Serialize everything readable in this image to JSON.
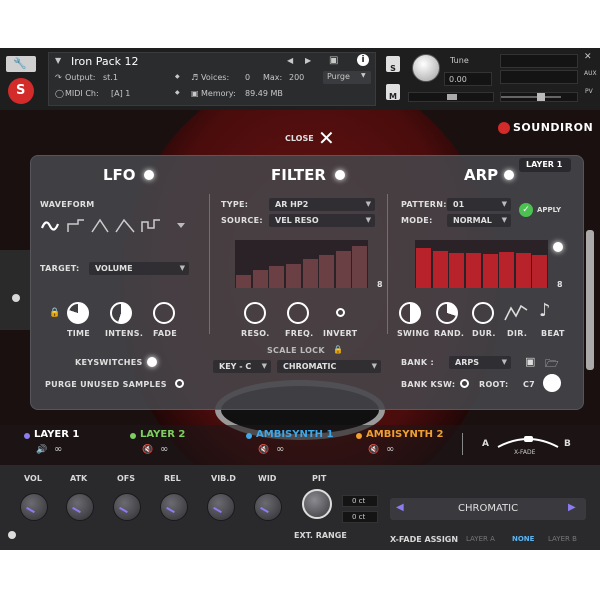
{
  "header": {
    "instrument_name": "Iron Pack 12",
    "output_label": "Output:",
    "output_value": "st.1",
    "voices_label": "Voices:",
    "voices_value": "0",
    "max_label": "Max:",
    "max_value": "200",
    "purge_label": "Purge",
    "midi_label": "MIDI Ch:",
    "midi_value": "[A] 1",
    "memory_label": "Memory:",
    "memory_value": "89.49 MB",
    "tune_label": "Tune",
    "tune_value": "0.00",
    "s_label": "S",
    "m_label": "M",
    "aux_label": "AUX",
    "pv_label": "PV"
  },
  "instrument": {
    "close_label": "CLOSE",
    "brand": "SOUNDIRON",
    "layer_badge": "LAYER 1",
    "lfo": {
      "title": "LFO",
      "waveform_label": "WAVEFORM",
      "target_label": "TARGET:",
      "target_value": "VOLUME",
      "knobs": [
        "TIME",
        "INTENS.",
        "FADE"
      ],
      "keyswitches_label": "KEYSWITCHES",
      "purge_label": "PURGE UNUSED SAMPLES"
    },
    "filter": {
      "title": "FILTER",
      "type_label": "TYPE:",
      "type_value": "AR HP2",
      "source_label": "SOURCE:",
      "source_value": "VEL RESO",
      "steps_count": "8",
      "knobs": [
        "RESO.",
        "FREQ.",
        "INVERT"
      ],
      "scale_lock_label": "SCALE LOCK",
      "key_value": "KEY - C",
      "scale_value": "CHROMATIC"
    },
    "arp": {
      "title": "ARP",
      "pattern_label": "PATTERN:",
      "pattern_value": "01",
      "mode_label": "MODE:",
      "mode_value": "NORMAL",
      "apply_label": "APPLY",
      "steps_count": "8",
      "step_values": [
        0.9,
        0.85,
        0.8,
        0.8,
        0.78,
        0.82,
        0.8,
        0.75
      ],
      "knobs": [
        "SWING",
        "RAND.",
        "DUR.",
        "DIR.",
        "BEAT"
      ],
      "bank_label": "BANK :",
      "bank_value": "ARPS",
      "bank_ksw_label": "BANK KSW:",
      "root_label": "ROOT:",
      "root_value": "C7"
    },
    "filter_step_values": [
      0.3,
      0.4,
      0.5,
      0.55,
      0.65,
      0.75,
      0.85,
      0.95
    ],
    "layers": [
      {
        "name": "LAYER 1",
        "color": "#8b7cf0",
        "active": true
      },
      {
        "name": "LAYER 2",
        "color": "#7bd060",
        "active": false
      },
      {
        "name": "AMBISYNTH 1",
        "color": "#3fa8e8",
        "active": false
      },
      {
        "name": "AMBISYNTH 2",
        "color": "#f0a030",
        "active": false
      }
    ],
    "xfade": {
      "a_label": "A",
      "b_label": "B",
      "label": "X-FADE"
    }
  },
  "bottom": {
    "knobs": [
      "VOL",
      "ATK",
      "OFS",
      "REL",
      "VIB.D",
      "WID"
    ],
    "pit_label": "PIT",
    "ct_top": "0 ct",
    "ct_bottom": "0 ct",
    "ext_range_label": "EXT. RANGE",
    "scale_display": "CHROMATIC",
    "xfade_assign_label": "X-FADE ASSIGN",
    "xfade_options": [
      "LAYER A",
      "NONE",
      "LAYER B"
    ],
    "xfade_selected": "NONE"
  },
  "colors": {
    "accent_red": "#d32a2a",
    "accent_purple": "#8b7cf0",
    "panel_bg": "#46464a"
  }
}
